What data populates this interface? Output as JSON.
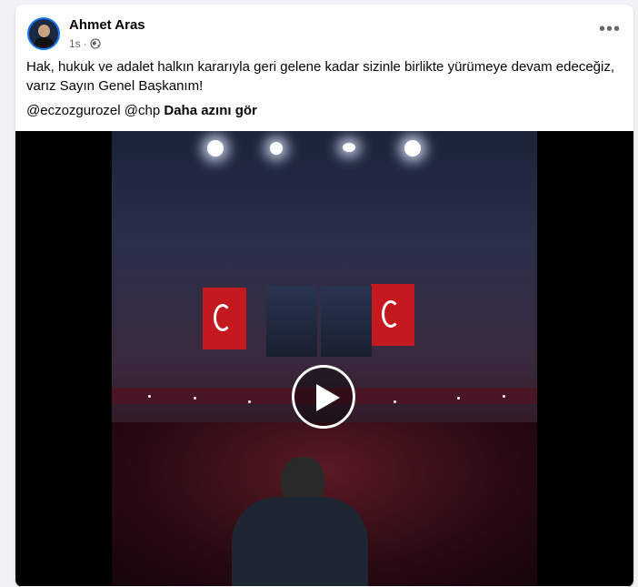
{
  "post": {
    "author": "Ahmet Aras",
    "timestamp": "1s",
    "separator": "·",
    "text": "Hak, hukuk ve adalet halkın kararıyla geri gelene kadar sizinle birlikte yürümeye devam edeceğiz, varız Sayın Genel Başkanım!",
    "mentions": "@eczozgurozel @chp",
    "see_more": "Daha azını gör",
    "more_options": "•••"
  },
  "icons": {
    "audience": "globe-icon",
    "options": "more-options-icon",
    "video": "play-icon"
  },
  "colors": {
    "accent": "#1877f2",
    "text": "#050505",
    "secondary_text": "#65676b",
    "background": "#f0f2f5"
  }
}
